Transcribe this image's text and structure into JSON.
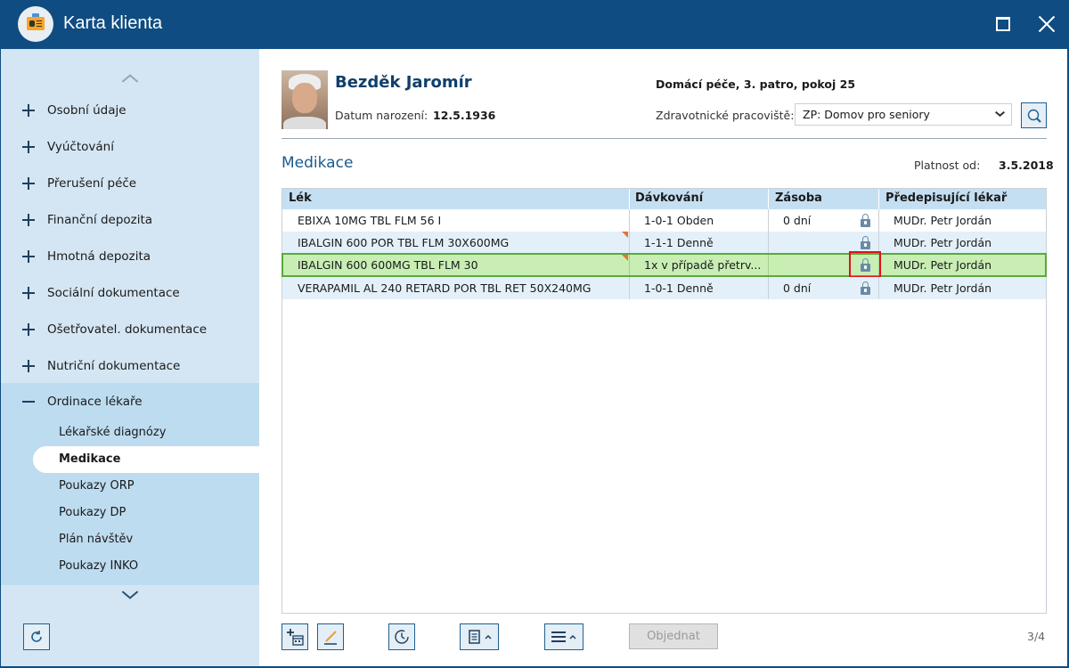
{
  "window": {
    "title": "Karta klienta",
    "maximize_icon": "maximize-icon",
    "close_icon": "close-icon"
  },
  "sidebar": {
    "items": [
      {
        "label": "Osobní údaje",
        "icon": "plus-icon"
      },
      {
        "label": "Vyúčtování",
        "icon": "plus-icon"
      },
      {
        "label": "Přerušení péče",
        "icon": "plus-icon"
      },
      {
        "label": "Finanční depozita",
        "icon": "plus-icon"
      },
      {
        "label": "Hmotná depozita",
        "icon": "plus-icon"
      },
      {
        "label": "Sociální dokumentace",
        "icon": "plus-icon"
      },
      {
        "label": "Ošetřovatel. dokumentace",
        "icon": "plus-icon"
      },
      {
        "label": "Nutriční dokumentace",
        "icon": "plus-icon"
      },
      {
        "label": "Ordinace lékaře",
        "icon": "minus-icon",
        "expanded": true
      }
    ],
    "subitems": [
      {
        "label": "Lékařské diagnózy"
      },
      {
        "label": "Medikace",
        "active": true
      },
      {
        "label": "Poukazy ORP"
      },
      {
        "label": "Poukazy DP"
      },
      {
        "label": "Plán návštěv"
      },
      {
        "label": "Poukazy INKO"
      }
    ]
  },
  "patient": {
    "name": "Bezděk Jaromír",
    "dob_label": "Datum narození:",
    "dob": "12.5.1936",
    "location": "Domácí péče, 3. patro, pokoj 25",
    "facility_label": "Zdravotnické pracoviště:",
    "facility_value": "ZP: Domov pro seniory"
  },
  "section": {
    "title": "Medikace",
    "validity_label": "Platnost od:",
    "validity_value": "3.5.2018"
  },
  "table": {
    "columns": [
      "Lék",
      "Dávkování",
      "Zásoba",
      "Předepisující lékař"
    ],
    "rows": [
      {
        "drug": "EBIXA 10MG TBL FLM 56 I",
        "dosage": "1-0-1 Obden",
        "stock": "0 dní",
        "doctor": "MUDr. Petr Jordán",
        "note": false,
        "selected": false
      },
      {
        "drug": "IBALGIN 600 POR TBL FLM 30X600MG",
        "dosage": "1-1-1 Denně",
        "stock": "",
        "doctor": "MUDr. Petr Jordán",
        "note": true,
        "selected": false
      },
      {
        "drug": "IBALGIN 600 600MG TBL FLM 30",
        "dosage": "1x v případě přetrv...",
        "stock": "",
        "doctor": "MUDr. Petr Jordán",
        "note": true,
        "selected": true
      },
      {
        "drug": "VERAPAMIL AL 240 RETARD POR TBL RET 50X240MG",
        "dosage": "1-0-1 Denně",
        "stock": "0 dní",
        "doctor": "MUDr. Petr Jordán",
        "note": false,
        "selected": false
      }
    ]
  },
  "toolbar": {
    "order_label": "Objednat",
    "page_counter": "3/4",
    "icons": [
      "add-calendar-icon",
      "edit-icon",
      "history-icon",
      "document-menu-icon",
      "list-menu-icon"
    ]
  },
  "colors": {
    "titlebar": "#0f4c81",
    "sidebar_bg": "#d4e6f4",
    "selected_row": "#c8eeb4",
    "highlight": "#e3101a"
  }
}
